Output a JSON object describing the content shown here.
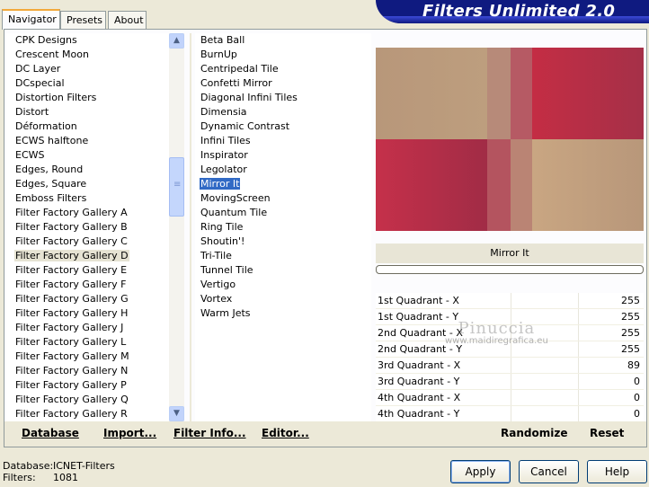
{
  "tabs": [
    {
      "label": "Navigator",
      "active": true
    },
    {
      "label": "Presets",
      "active": false
    },
    {
      "label": "About",
      "active": false
    }
  ],
  "app": {
    "title": "Filters Unlimited 2.0"
  },
  "categories": {
    "items": [
      "CPK Designs",
      "Crescent Moon",
      "DC Layer",
      "DCspecial",
      "Distortion Filters",
      "Distort",
      "Déformation",
      "ECWS halftone",
      "ECWS",
      "Edges, Round",
      "Edges, Square",
      "Emboss Filters",
      "Filter Factory Gallery A",
      "Filter Factory Gallery B",
      "Filter Factory Gallery C",
      "Filter Factory Gallery D",
      "Filter Factory Gallery E",
      "Filter Factory Gallery F",
      "Filter Factory Gallery G",
      "Filter Factory Gallery H",
      "Filter Factory Gallery J",
      "Filter Factory Gallery L",
      "Filter Factory Gallery M",
      "Filter Factory Gallery N",
      "Filter Factory Gallery P",
      "Filter Factory Gallery Q",
      "Filter Factory Gallery R"
    ],
    "selected": "Filter Factory Gallery D"
  },
  "filters": {
    "items": [
      "Beta Ball",
      "BurnUp",
      "Centripedal Tile",
      "Confetti Mirror",
      "Diagonal Infini Tiles",
      "Dimensia",
      "Dynamic Contrast",
      "Infini Tiles",
      "Inspirator",
      "Legolator",
      "Mirror It",
      "MovingScreen",
      "Quantum Tile",
      "Ring Tile",
      "Shoutin'!",
      "Tri-Tile",
      "Tunnel Tile",
      "Vertigo",
      "Vortex",
      "Warm Jets"
    ],
    "selected": "Mirror It"
  },
  "preview": {
    "filter_name": "Mirror It"
  },
  "parameters": [
    {
      "label": "1st Quadrant - X",
      "value": "255"
    },
    {
      "label": "1st Quadrant - Y",
      "value": "255"
    },
    {
      "label": "2nd Quadrant - X",
      "value": "255"
    },
    {
      "label": "2nd Quadrant - Y",
      "value": "255"
    },
    {
      "label": "3rd Quadrant - X",
      "value": "89"
    },
    {
      "label": "3rd Quadrant - Y",
      "value": "0"
    },
    {
      "label": "4th Quadrant - X",
      "value": "0"
    },
    {
      "label": "4th Quadrant - Y",
      "value": "0"
    }
  ],
  "watermark": {
    "line1": "Pinuccia",
    "line2": "www.maidiregrafica.eu"
  },
  "toolbar": {
    "database": "Database",
    "import": "Import...",
    "filter_info": "Filter Info...",
    "editor": "Editor...",
    "randomize": "Randomize",
    "reset": "Reset"
  },
  "status": {
    "database_label": "Database:",
    "database_value": "ICNET-Filters",
    "filters_label": "Filters:",
    "filters_value": "1081"
  },
  "buttons": {
    "apply": "Apply",
    "cancel": "Cancel",
    "help": "Help"
  },
  "colors": {
    "selection": "#316ac5",
    "banner": "#0f1a80",
    "tab_accent": "#f2a93b"
  }
}
